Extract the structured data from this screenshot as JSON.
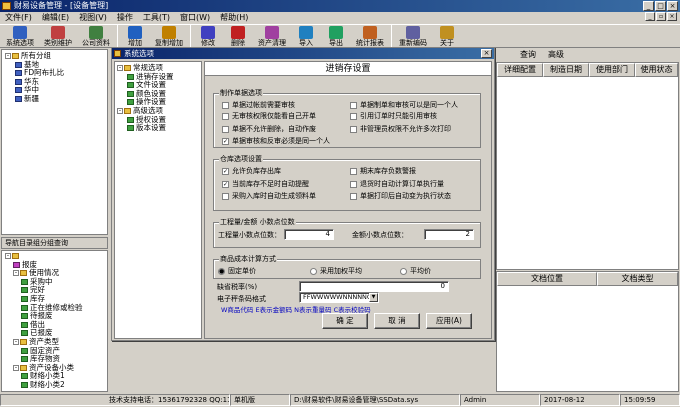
{
  "window": {
    "title": "财易设备管理 - [设备管理]"
  },
  "menu": [
    "文件(F)",
    "编辑(E)",
    "视图(V)",
    "操作",
    "工具(T)",
    "窗口(W)",
    "帮助(H)"
  ],
  "toolbar": [
    {
      "label": "系统选项",
      "icon": "gear-icon",
      "color": "#3060c0"
    },
    {
      "label": "类别维护",
      "icon": "category-icon",
      "color": "#c04040"
    },
    {
      "label": "公司资料",
      "icon": "company-icon",
      "color": "#408040"
    },
    {
      "label": "增加",
      "icon": "add-icon",
      "color": "#2060c0"
    },
    {
      "label": "复制增加",
      "icon": "copy-add-icon",
      "color": "#c08000"
    },
    {
      "label": "修改",
      "icon": "edit-icon",
      "color": "#4040c0"
    },
    {
      "label": "删除",
      "icon": "delete-icon",
      "color": "#c02020"
    },
    {
      "label": "资产清理",
      "icon": "clean-icon",
      "color": "#a040a0"
    },
    {
      "label": "导入",
      "icon": "import-icon",
      "color": "#2080c0"
    },
    {
      "label": "导出",
      "icon": "export-icon",
      "color": "#20a060"
    },
    {
      "label": "统计报表",
      "icon": "report-icon",
      "color": "#c06020"
    },
    {
      "label": "重新编码",
      "icon": "recode-icon",
      "color": "#6060a0"
    },
    {
      "label": "关于",
      "icon": "about-icon",
      "color": "#c09020"
    }
  ],
  "left_tree_top": [
    {
      "label": "所有分组",
      "level": 0,
      "icon": "y",
      "pm": "-"
    },
    {
      "label": "基地",
      "level": 1,
      "icon": "b"
    },
    {
      "label": "FD阿布扎比",
      "level": 1,
      "icon": "b"
    },
    {
      "label": "华东",
      "level": 1,
      "icon": "b"
    },
    {
      "label": "华中",
      "level": 1,
      "icon": "b"
    },
    {
      "label": "新疆",
      "level": 1,
      "icon": "b"
    }
  ],
  "left_lower_title": "导航目录组分组查询",
  "left_tree_bottom": [
    {
      "label": "",
      "level": 0,
      "icon": "y",
      "pm": "-"
    },
    {
      "label": "报废",
      "level": 1,
      "icon": "p"
    },
    {
      "label": "使用情况",
      "level": 1,
      "icon": "y",
      "pm": "-"
    },
    {
      "label": "采购中",
      "level": 2,
      "icon": "g"
    },
    {
      "label": "完好",
      "level": 2,
      "icon": "g"
    },
    {
      "label": "库存",
      "level": 2,
      "icon": "g"
    },
    {
      "label": "正在维修或检验",
      "level": 2,
      "icon": "g"
    },
    {
      "label": "待报废",
      "level": 2,
      "icon": "g"
    },
    {
      "label": "借出",
      "level": 2,
      "icon": "g"
    },
    {
      "label": "已报废",
      "level": 2,
      "icon": "g"
    },
    {
      "label": "资产类型",
      "level": 1,
      "icon": "y",
      "pm": "-"
    },
    {
      "label": "固定资产",
      "level": 2,
      "icon": "g"
    },
    {
      "label": "库存物资",
      "level": 2,
      "icon": "g"
    },
    {
      "label": "资产设备小类",
      "level": 1,
      "icon": "y",
      "pm": "-"
    },
    {
      "label": "财络小类1",
      "level": 2,
      "icon": "g"
    },
    {
      "label": "财络小类2",
      "level": 2,
      "icon": "g"
    }
  ],
  "right_tabs": [
    "查询",
    "高级"
  ],
  "right_headers_top": [
    "详细配置",
    "制造日期",
    "使用部门",
    "使用状态"
  ],
  "right_headers_bottom": [
    "文档位置",
    "文档类型"
  ],
  "status": [
    "技术支持电话：15361792328 QQ:1113886749",
    "单机版",
    "D:\\财易软件\\财易设备管理\\SSData.sys",
    "Admin",
    "2017-08-12",
    "15:09:59"
  ],
  "dialog": {
    "title": "系统选项",
    "tree": [
      {
        "label": "常规选项",
        "level": 0
      },
      {
        "label": "进销存设置",
        "level": 1
      },
      {
        "label": "文件设置",
        "level": 1
      },
      {
        "label": "颜色设置",
        "level": 1
      },
      {
        "label": "操作设置",
        "level": 1
      },
      {
        "label": "高级选项",
        "level": 0
      },
      {
        "label": "授权设置",
        "level": 1
      },
      {
        "label": "版本设置",
        "level": 1
      }
    ],
    "panel_title": "进销存设置",
    "group1": {
      "title": "制作单据选项",
      "items": [
        {
          "label": "单据过帐前需要审核",
          "checked": false
        },
        {
          "label": "单据制单和审核可以是同一个人",
          "checked": false
        },
        {
          "label": "无审核权限仅能看自己开单",
          "checked": false
        },
        {
          "label": "引用订单时只能引用审核",
          "checked": false
        },
        {
          "label": "单据不允许删除，自动作废",
          "checked": false
        },
        {
          "label": "非管理员权限不允许多次打印",
          "checked": false
        },
        {
          "label": "单据审核和反审必须是同一个人",
          "checked": true
        }
      ]
    },
    "group2": {
      "title": "仓库选项设置",
      "items": [
        {
          "label": "允许负库存出库",
          "checked": true
        },
        {
          "label": "期末库存负数警报",
          "checked": false
        },
        {
          "label": "当前库存不足时自动提醒",
          "checked": true
        },
        {
          "label": "退货时自动计算订单执行量",
          "checked": false
        },
        {
          "label": "采购入库时自动生成领料单",
          "checked": false
        },
        {
          "label": "单据打印后自动变为执行状态",
          "checked": false
        }
      ]
    },
    "group3": {
      "title": "工程量/金额 小数点位数",
      "qty_label": "工程量小数点位数：",
      "qty_value": "4",
      "amt_label": "金额小数点位数：",
      "amt_value": "2"
    },
    "group4": {
      "title": "商品成本计算方式",
      "options": [
        {
          "label": "固定单价",
          "selected": true
        },
        {
          "label": "采用加权平均",
          "selected": false
        },
        {
          "label": "平均价",
          "selected": false
        }
      ]
    },
    "tax_label": "缺省税率(%)",
    "tax_value": "0",
    "barcode_label": "电子秤条码格式",
    "barcode_value": "FFWWWWWNNNNNC",
    "barcode_hint": "W商品代码 E表示金额码 N表示重量码 C表示校验码",
    "buttons": [
      "确 定",
      "取 消",
      "应用(A)"
    ]
  }
}
